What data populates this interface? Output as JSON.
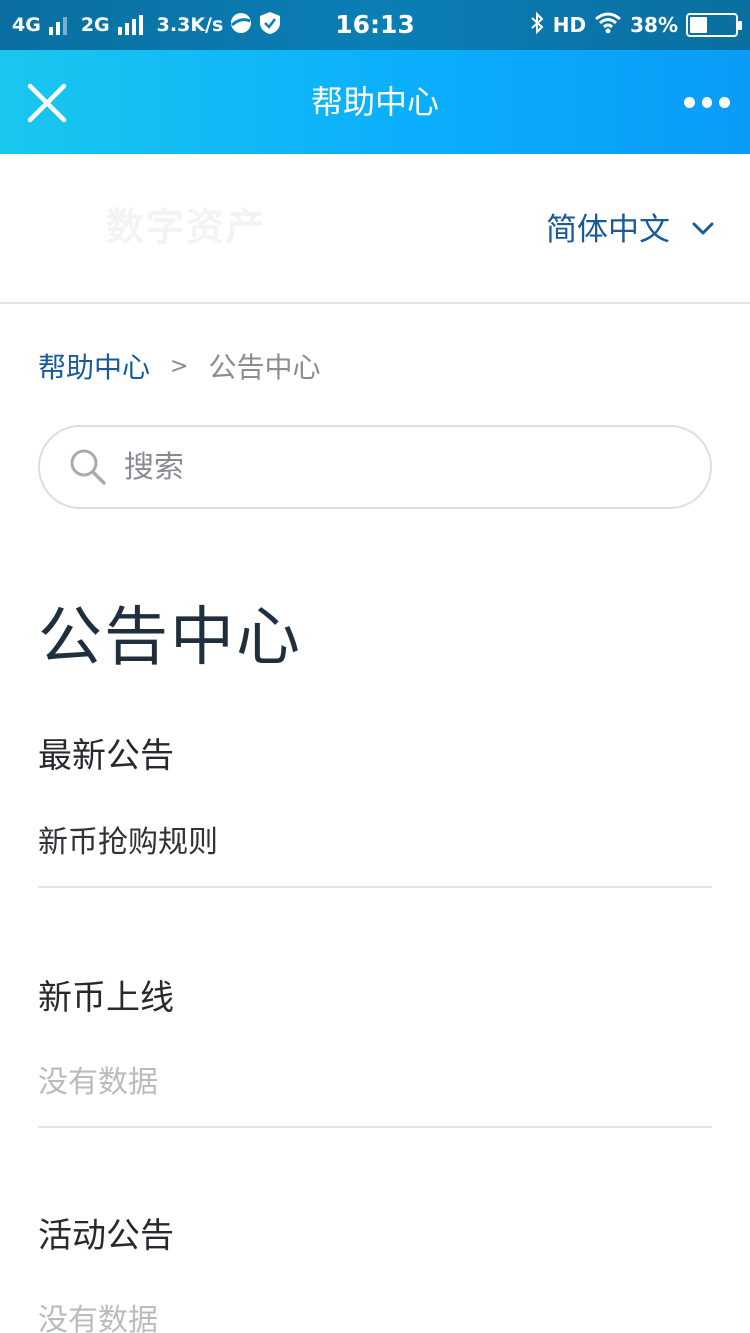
{
  "status_bar": {
    "network1": "4G",
    "network2": "2G",
    "speed": "3.3K/s",
    "time": "16:13",
    "hd": "HD",
    "battery": "38%",
    "battery_level": 0.38
  },
  "nav": {
    "title": "帮助中心"
  },
  "header": {
    "brand": "数字资产",
    "language": "简体中文"
  },
  "breadcrumb": {
    "home": "帮助中心",
    "separator": ">",
    "current": "公告中心"
  },
  "search": {
    "placeholder": "搜索"
  },
  "page_title": "公告中心",
  "sections": [
    {
      "title": "最新公告",
      "item": "新币抢购规则"
    },
    {
      "title": "新币上线",
      "empty": "没有数据"
    },
    {
      "title": "活动公告",
      "empty": "没有数据"
    }
  ]
}
